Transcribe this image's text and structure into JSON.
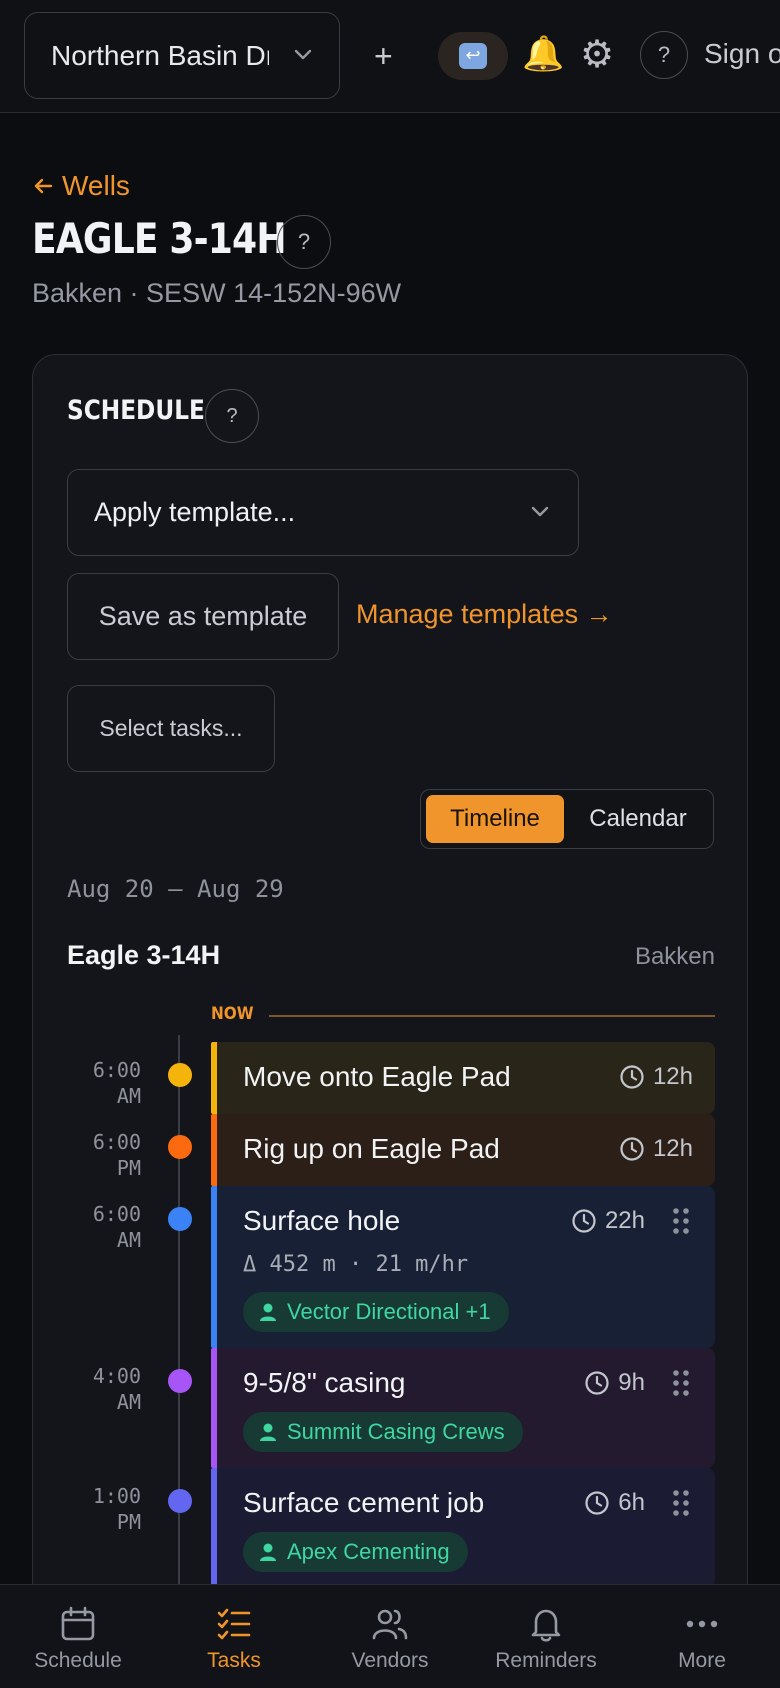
{
  "topbar": {
    "org_select_value": "Northern Basin Drilling",
    "add_label": "+",
    "return_icon": "return-icon",
    "notifications_icon": "bell-icon",
    "settings_icon": "gear-icon",
    "help_label": "?",
    "signin_label": "Sign out"
  },
  "header": {
    "back_label": "Wells",
    "title": "EAGLE 3-14H",
    "help_label": "?",
    "subtitle": "Bakken · SESW 14-152N-96W"
  },
  "schedule": {
    "title": "SCHEDULE",
    "help_label": "?",
    "apply_template_label": "Apply template...",
    "save_template_label": "Save as template",
    "manage_templates_label": "Manage templates →",
    "select_tasks_label": "Select tasks...",
    "view_toggle": {
      "timeline": "Timeline",
      "calendar": "Calendar",
      "selected": "Timeline"
    },
    "date_range": "Aug 20 – Aug 29",
    "group_name": "Eagle 3-14H",
    "group_region": "Bakken",
    "now_label": "NOW",
    "tasks": [
      {
        "time_line1": "6:00",
        "time_line2": "AM",
        "name": "Move onto Eagle Pad",
        "duration": "12h",
        "color": "#f5b40b",
        "bg": "#2a2519"
      },
      {
        "time_line1": "6:00",
        "time_line2": "PM",
        "name": "Rig up on Eagle Pad",
        "duration": "12h",
        "color": "#fb6a0f",
        "bg": "#2c1f17"
      },
      {
        "time_line1": "6:00",
        "time_line2": "AM",
        "name": "Surface hole",
        "duration": "22h",
        "meta": "Δ 452 m · 21 m/hr",
        "vendor": "Vector Directional +1",
        "color": "#3b82f6",
        "bg": "#172034"
      },
      {
        "time_line1": "4:00",
        "time_line2": "AM",
        "name": "9-5/8\" casing",
        "duration": "9h",
        "vendor": "Summit Casing Crews",
        "color": "#a855f7",
        "bg": "#231a30"
      },
      {
        "time_line1": "1:00",
        "time_line2": "PM",
        "name": "Surface cement job",
        "duration": "6h",
        "vendor": "Apex Cementing",
        "color": "#6366f1",
        "bg": "#1b1c33"
      }
    ]
  },
  "bottom_nav": {
    "items": [
      {
        "label": "Schedule",
        "icon": "calendar-icon"
      },
      {
        "label": "Tasks",
        "icon": "tasks-icon",
        "active": true
      },
      {
        "label": "Vendors",
        "icon": "users-icon"
      },
      {
        "label": "Reminders",
        "icon": "bell-icon"
      },
      {
        "label": "More",
        "icon": "more-icon"
      }
    ]
  },
  "colors": {
    "accent": "#f0952b",
    "vendor_text": "#3fd6a0",
    "background": "#0c0d10"
  }
}
